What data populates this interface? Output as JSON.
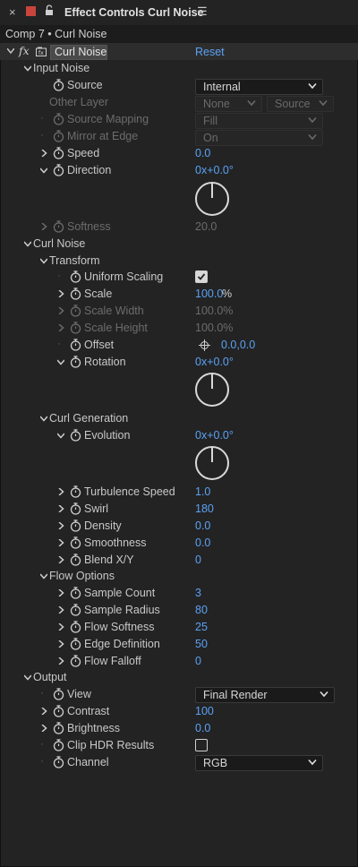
{
  "panel": {
    "close_glyph": "×",
    "title": "Effect Controls Curl Noise",
    "menu_glyph": "☰",
    "breadcrumb": "Comp 7 • Curl Noise"
  },
  "effect": {
    "fx_glyph": "fx",
    "name": "Curl Noise",
    "reset_label": "Reset"
  },
  "sections": {
    "input_noise": {
      "label": "Input Noise",
      "source": {
        "label": "Source",
        "value": "Internal"
      },
      "other_layer": {
        "label": "Other Layer",
        "layer_value": "None",
        "source_value": "Source"
      },
      "source_mapping": {
        "label": "Source Mapping",
        "value": "Fill"
      },
      "mirror_at_edge": {
        "label": "Mirror at Edge",
        "value": "On"
      },
      "speed": {
        "label": "Speed",
        "value": "0.0"
      },
      "direction": {
        "label": "Direction",
        "value": "0x+0.0°"
      },
      "softness": {
        "label": "Softness",
        "value": "20.0"
      }
    },
    "curl_noise": {
      "label": "Curl Noise",
      "transform": {
        "label": "Transform",
        "uniform_scaling": {
          "label": "Uniform Scaling",
          "checked": true
        },
        "scale": {
          "label": "Scale",
          "value": "100.0",
          "unit": "%"
        },
        "scale_width": {
          "label": "Scale Width",
          "value": "100.0%"
        },
        "scale_height": {
          "label": "Scale Height",
          "value": "100.0%"
        },
        "offset": {
          "label": "Offset",
          "value": "0.0,0.0"
        },
        "rotation": {
          "label": "Rotation",
          "value": "0x+0.0°"
        }
      },
      "curl_generation": {
        "label": "Curl Generation",
        "evolution": {
          "label": "Evolution",
          "value": "0x+0.0°"
        },
        "turbulence_speed": {
          "label": "Turbulence Speed",
          "value": "1.0"
        },
        "swirl": {
          "label": "Swirl",
          "value": "180"
        },
        "density": {
          "label": "Density",
          "value": "0.0"
        },
        "smoothness": {
          "label": "Smoothness",
          "value": "0.0"
        },
        "blend_xy": {
          "label": "Blend X/Y",
          "value": "0"
        }
      },
      "flow_options": {
        "label": "Flow Options",
        "sample_count": {
          "label": "Sample Count",
          "value": "3"
        },
        "sample_radius": {
          "label": "Sample Radius",
          "value": "80"
        },
        "flow_softness": {
          "label": "Flow Softness",
          "value": "25"
        },
        "edge_definition": {
          "label": "Edge Definition",
          "value": "50"
        },
        "flow_falloff": {
          "label": "Flow Falloff",
          "value": "0"
        }
      }
    },
    "output": {
      "label": "Output",
      "view": {
        "label": "View",
        "value": "Final Render"
      },
      "contrast": {
        "label": "Contrast",
        "value": "100"
      },
      "brightness": {
        "label": "Brightness",
        "value": "0.0"
      },
      "clip_hdr": {
        "label": "Clip HDR Results",
        "checked": false
      },
      "channel": {
        "label": "Channel",
        "value": "RGB"
      }
    }
  },
  "colors": {
    "value_blue": "#5aa2f5",
    "label_text": "#c8c8c8",
    "disabled_text": "#6c6c6c",
    "background": "#232323"
  },
  "icons": {
    "stopwatch": "stopwatch-icon",
    "chevron": "chevron-down-icon",
    "twirl": "twirl-arrow-icon",
    "crosshair": "crosshair-icon"
  }
}
